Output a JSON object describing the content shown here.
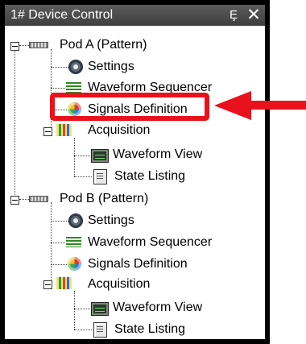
{
  "panel": {
    "title": "1# Device Control",
    "pin_glyph": "Ȩ",
    "pin_icon": "pin-icon",
    "close_glyph": "✕",
    "close_icon": "close-icon"
  },
  "tree": {
    "pods": [
      {
        "label": "Pod A (Pattern)",
        "expanded": true,
        "children": {
          "settings": "Settings",
          "sequencer": "Waveform Sequencer",
          "signals": "Signals Definition",
          "acquisition": {
            "label": "Acquisition",
            "expanded": true,
            "children": {
              "waveform_view": "Waveform View",
              "state_listing": "State Listing"
            }
          }
        }
      },
      {
        "label": "Pod B (Pattern)",
        "expanded": true,
        "children": {
          "settings": "Settings",
          "sequencer": "Waveform Sequencer",
          "signals": "Signals Definition",
          "acquisition": {
            "label": "Acquisition",
            "expanded": true,
            "children": {
              "waveform_view": "Waveform View",
              "state_listing": "State Listing"
            }
          }
        }
      }
    ]
  },
  "annotation": {
    "highlighted_item": "Signals Definition",
    "color": "#e8121c"
  },
  "icons": {
    "pod": "pod-connector-icon",
    "settings": "gear-icon",
    "sequencer": "waveform-sequencer-icon",
    "signals": "signals-definition-icon",
    "acquisition": "acquisition-icon",
    "waveform_view": "waveform-view-icon",
    "state_listing": "state-listing-icon"
  }
}
